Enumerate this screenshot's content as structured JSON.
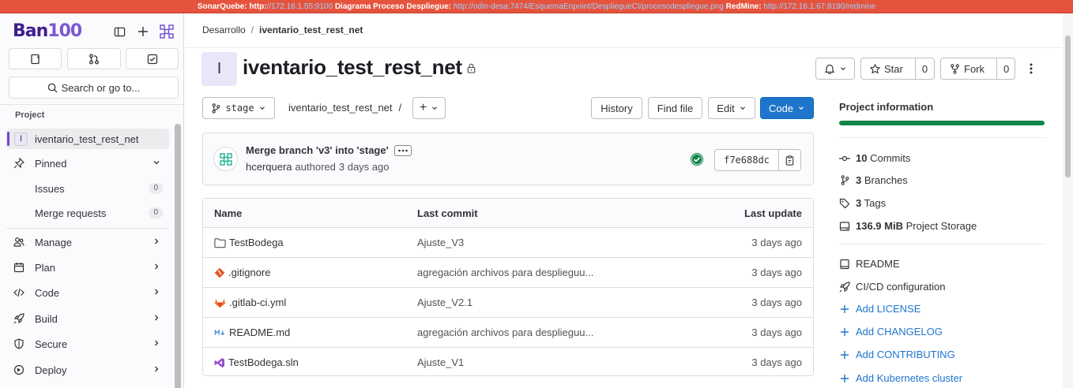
{
  "banner": {
    "label1": "SonarQuebe: http:",
    "link1": "//172.16.1.55:9100",
    "label2": "Diagrama Proceso Despliegue:",
    "link2": "http://odin-desa:7474/EsquemaEnpoint/DespliegueCI/procesodespliegue.png",
    "label3": "RedMine:",
    "link3": "http://172.16.1.67:8190/redmine"
  },
  "sidebar": {
    "logo_text": "Ban",
    "logo_num": "100",
    "search": "Search or go to...",
    "section": "Project",
    "project_item": {
      "avatar": "I",
      "label": "iventario_test_rest_net"
    },
    "pinned": "Pinned",
    "issues": {
      "label": "Issues",
      "count": "0"
    },
    "merge_requests": {
      "label": "Merge requests",
      "count": "0"
    },
    "items": [
      {
        "label": "Manage",
        "icon": "users-icon"
      },
      {
        "label": "Plan",
        "icon": "calendar-icon"
      },
      {
        "label": "Code",
        "icon": "code-icon"
      },
      {
        "label": "Build",
        "icon": "rocket-icon"
      },
      {
        "label": "Secure",
        "icon": "shield-icon"
      },
      {
        "label": "Deploy",
        "icon": "deploy-icon"
      }
    ]
  },
  "breadcrumb": {
    "parent": "Desarrollo",
    "sep": "/",
    "current": "iventario_test_rest_net"
  },
  "project": {
    "avatar": "I",
    "title": "iventario_test_rest_net"
  },
  "actions": {
    "star": "Star",
    "star_count": "0",
    "fork": "Fork",
    "fork_count": "0"
  },
  "repo_bar": {
    "branch": "stage",
    "path": "iventario_test_rest_net",
    "path_sep": "/",
    "add": "+",
    "history": "History",
    "find_file": "Find file",
    "edit": "Edit",
    "code": "Code"
  },
  "commit": {
    "message": "Merge branch 'v3' into 'stage'",
    "author": "hcerquera",
    "authored": "authored",
    "time": "3 days ago",
    "sha": "f7e688dc",
    "status_color": "#108548"
  },
  "table": {
    "headers": {
      "name": "Name",
      "last_commit": "Last commit",
      "last_update": "Last update"
    },
    "rows": [
      {
        "name": "TestBodega",
        "icon": "folder-icon",
        "commit": "Ajuste_V3",
        "updated": "3 days ago"
      },
      {
        "name": ".gitignore",
        "icon": "git-icon",
        "commit": "agregación archivos para desplieguu...",
        "updated": "3 days ago"
      },
      {
        "name": ".gitlab-ci.yml",
        "icon": "gitlab-icon",
        "commit": "Ajuste_V2.1",
        "updated": "3 days ago"
      },
      {
        "name": "README.md",
        "icon": "markdown-icon",
        "commit": "agregación archivos para desplieguu...",
        "updated": "3 days ago"
      },
      {
        "name": "TestBodega.sln",
        "icon": "visual-studio-icon",
        "commit": "Ajuste_V1",
        "updated": "3 days ago"
      }
    ]
  },
  "project_info": {
    "title": "Project information",
    "commits": {
      "num": "10",
      "label": "Commits"
    },
    "branches": {
      "num": "3",
      "label": "Branches"
    },
    "tags": {
      "num": "3",
      "label": "Tags"
    },
    "storage": {
      "num": "136.9 MiB",
      "label": "Project Storage"
    },
    "readme": "README",
    "cicd": "CI/CD configuration",
    "add_license": "Add LICENSE",
    "add_changelog": "Add CHANGELOG",
    "add_contributing": "Add CONTRIBUTING",
    "add_k8s": "Add Kubernetes cluster"
  },
  "colors": {
    "accent": "#1f75cb",
    "brand": "#6e49cb",
    "banner": "#e5533d",
    "success": "#108548"
  }
}
